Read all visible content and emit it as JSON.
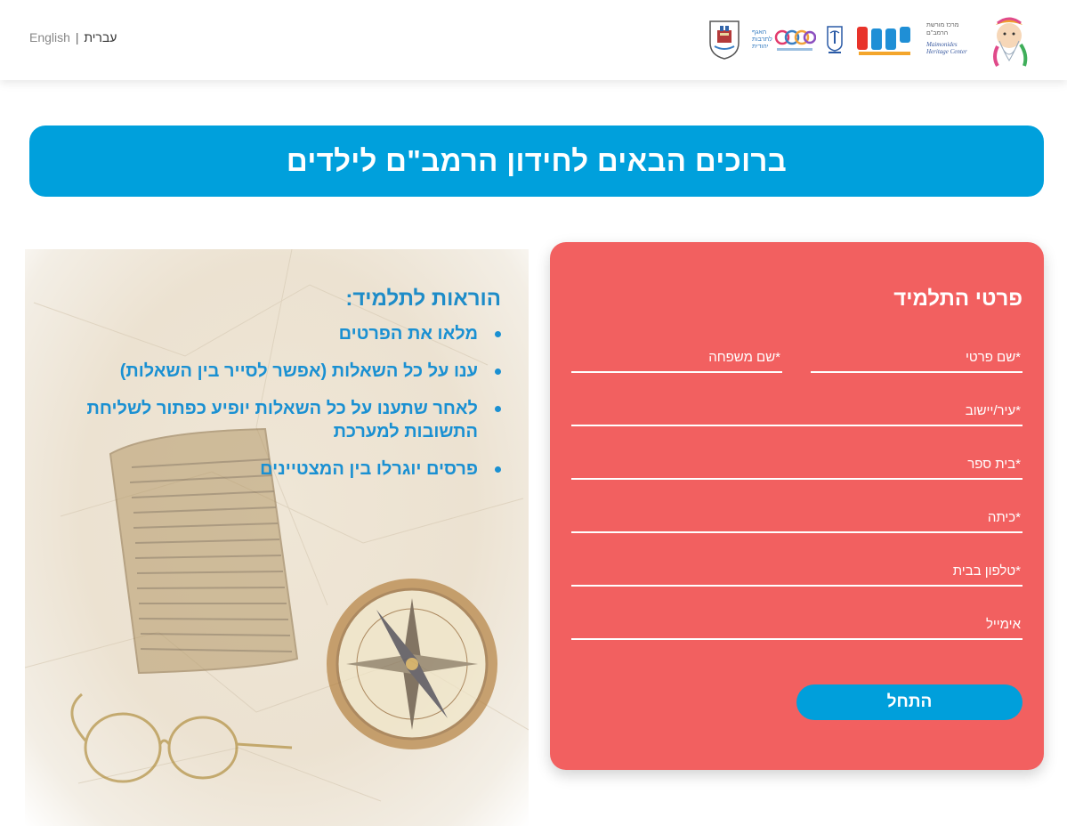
{
  "header": {
    "lang_english": "English",
    "lang_separator": "|",
    "lang_hebrew": "עברית",
    "logos": [
      "maimonides-heritage-center-logo",
      "hemed-logo",
      "israel-emblem-logo",
      "jewish-culture-logo",
      "tiberias-municipality-crest"
    ]
  },
  "banner": {
    "title": "ברוכים הבאים לחידון הרמב\"ם לילדים"
  },
  "instructions": {
    "heading": "הוראות לתלמיד:",
    "items": [
      "מלאו את הפרטים",
      "ענו על כל השאלות (אפשר לסייר בין השאלות)",
      "לאחר שתענו על כל השאלות יופיע כפתור לשליחת התשובות למערכת",
      "פרסים יוגרלו בין המצטיינים"
    ]
  },
  "form": {
    "title": "פרטי התלמיד",
    "first_name_placeholder": "*שם פרטי",
    "last_name_placeholder": "*שם משפחה",
    "city_placeholder": "*עיר/יישוב",
    "school_placeholder": "*בית ספר",
    "class_placeholder": "*כיתה",
    "phone_placeholder": "*טלפון בבית",
    "email_placeholder": "אימייל",
    "start_label": "התחל"
  },
  "colors": {
    "accent_blue": "#00a0dc",
    "card_red": "#f26060",
    "instruction_text": "#1a90d2",
    "paper_beige": "#ece2d1"
  }
}
